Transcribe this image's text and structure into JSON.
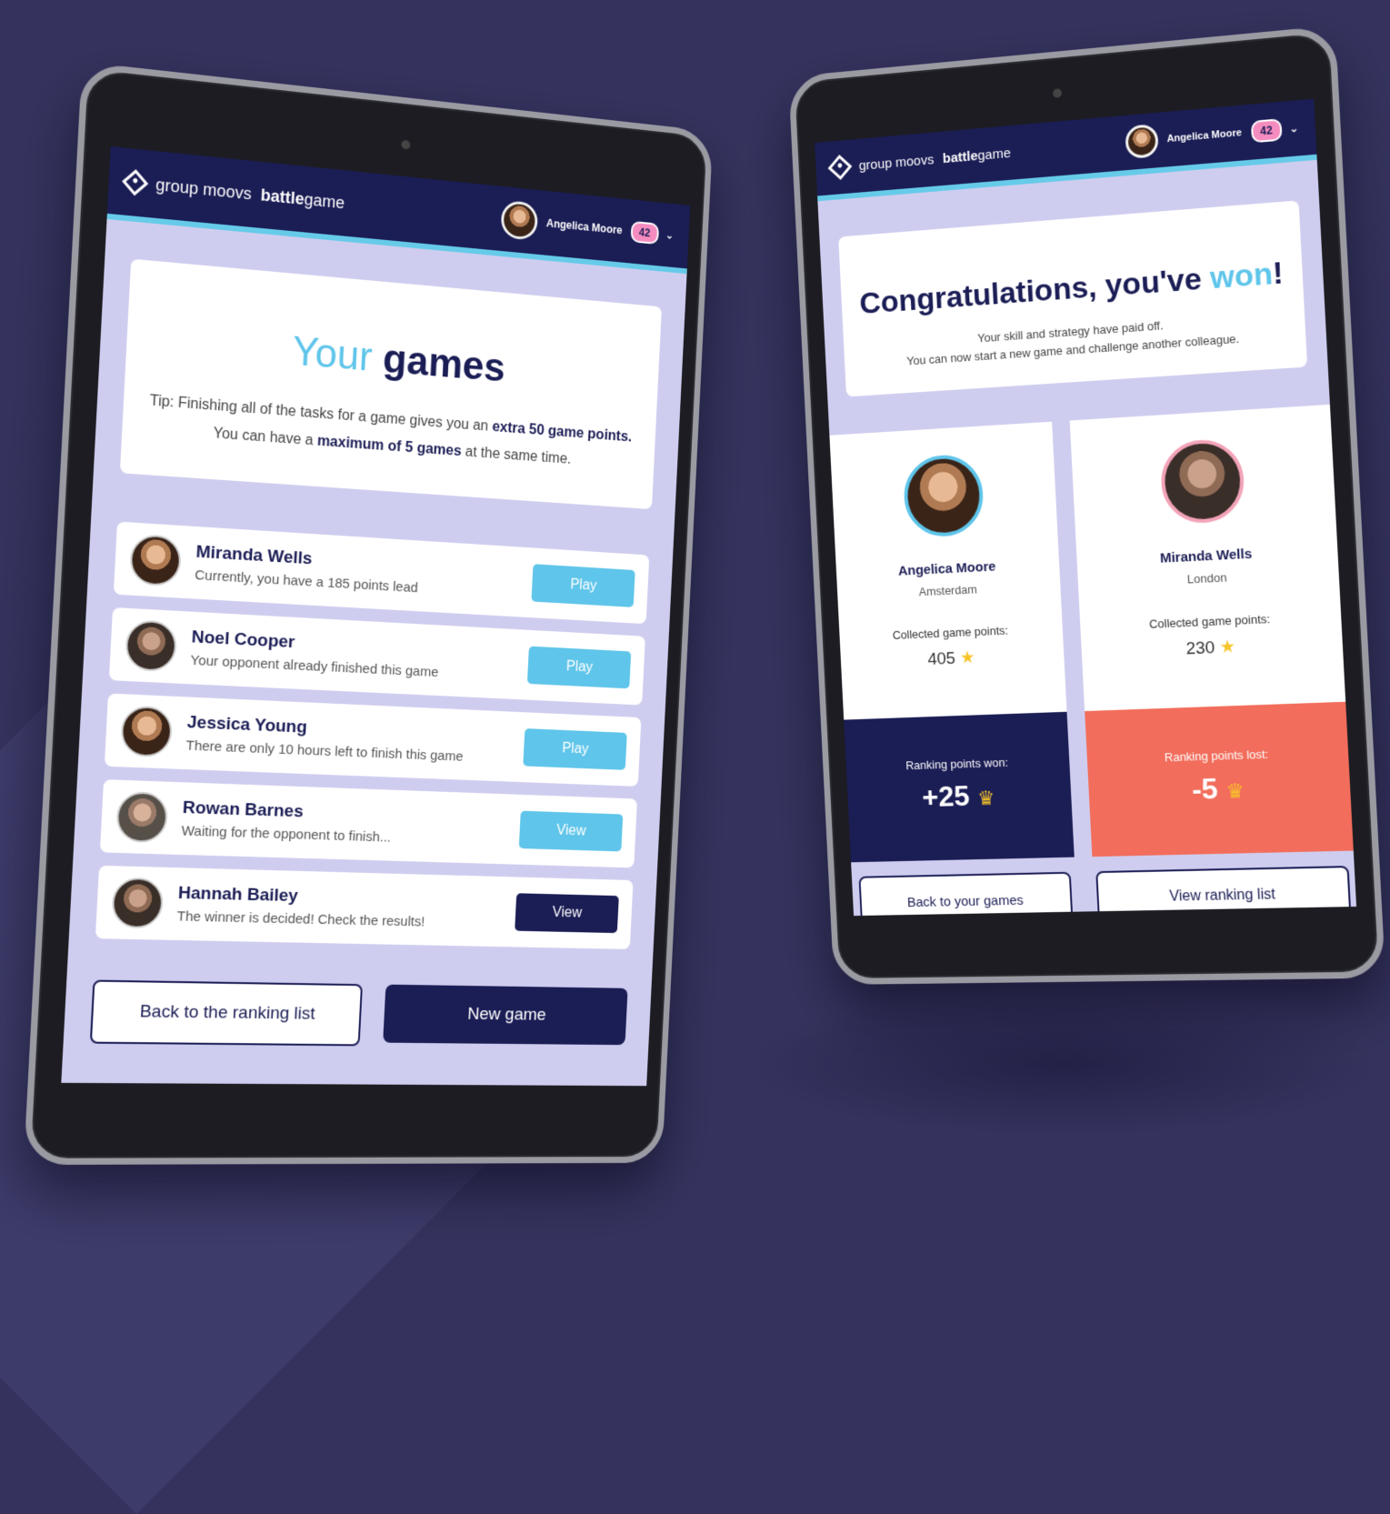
{
  "header": {
    "brand": "group moovs",
    "product_prefix": "battle",
    "product_suffix": "game",
    "user_name": "Angelica Moore",
    "badge_count": "42",
    "caret": "⌄"
  },
  "games_screen": {
    "title_accent": "Your",
    "title_rest": "games",
    "tip_line1_a": "Tip: Finishing all of the tasks for a game gives you an ",
    "tip_line1_b": "extra 50 game points.",
    "tip_line2_a": "You can have a ",
    "tip_line2_b": "maximum of 5 games",
    "tip_line2_c": " at the same time.",
    "rows": [
      {
        "name": "Miranda Wells",
        "status": "Currently, you have a 185 points lead",
        "action": "Play"
      },
      {
        "name": "Noel Cooper",
        "status": "Your opponent already finished this game",
        "action": "Play"
      },
      {
        "name": "Jessica Young",
        "status": "There are only 10 hours left to finish this game",
        "action": "Play"
      },
      {
        "name": "Rowan Barnes",
        "status": "Waiting for the opponent to finish...",
        "action": "View"
      },
      {
        "name": "Hannah Bailey",
        "status": "The winner is decided! Check the results!",
        "action": "View"
      }
    ],
    "back_button": "Back to the ranking list",
    "new_game_button": "New game"
  },
  "result_screen": {
    "title_a": "Congratulations, you've ",
    "title_accent": "won",
    "title_b": "!",
    "sub1": "Your skill and strategy have paid off.",
    "sub2": "You can now start a new game and challenge another colleague.",
    "player1": {
      "name": "Angelica Moore",
      "city": "Amsterdam",
      "points_label": "Collected game points:",
      "points": "405",
      "rank_label": "Ranking points won:",
      "rank_value": "+25"
    },
    "player2": {
      "name": "Miranda Wells",
      "city": "London",
      "points_label": "Collected game points:",
      "points": "230",
      "rank_label": "Ranking points lost:",
      "rank_value": "-5"
    },
    "back_button": "Back to your games",
    "ranking_button": "View ranking list"
  },
  "colors": {
    "navy": "#1b1d55",
    "cyan": "#5fc5ea",
    "coral": "#f26d5b",
    "screen_bg": "#cfcdef",
    "badge": "#f58cc0"
  },
  "icons": [
    "diamond-logo-icon",
    "chevron-down-icon",
    "star-icon",
    "crown-icon"
  ]
}
